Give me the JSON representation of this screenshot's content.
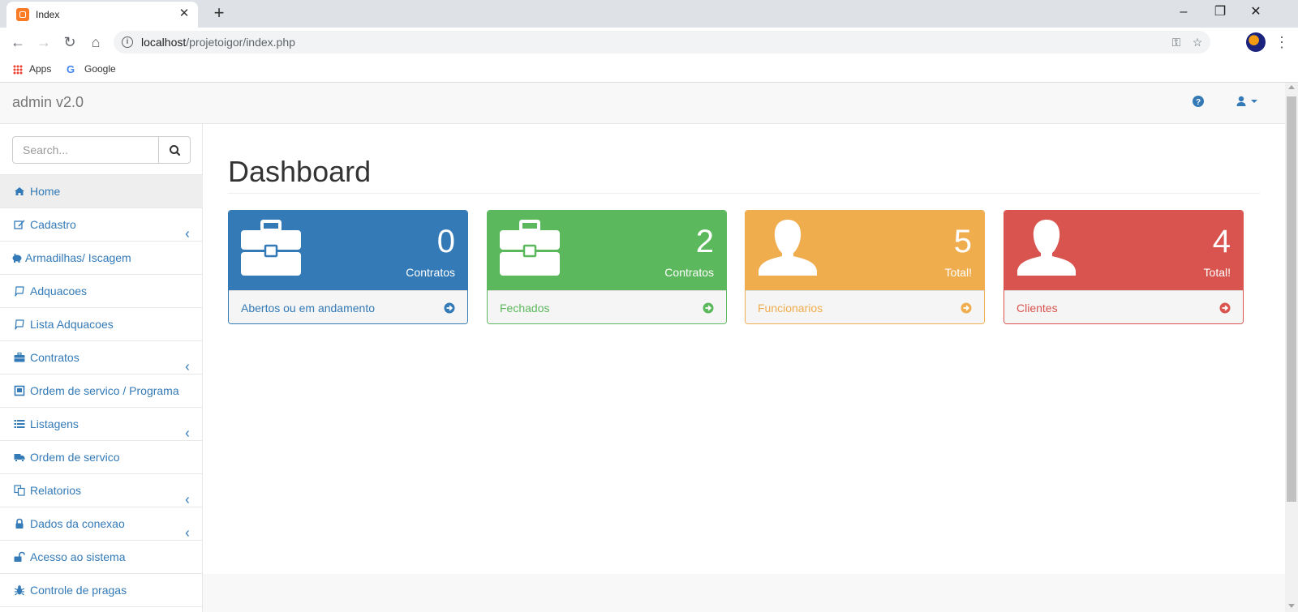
{
  "browser": {
    "tab_title": "Index",
    "url_host": "localhost",
    "url_path": "/projetoigor/index.php",
    "bookmarks": [
      {
        "label": "Apps"
      },
      {
        "label": "Google"
      }
    ]
  },
  "app": {
    "brand": "admin v2.0",
    "search_placeholder": "Search..."
  },
  "sidebar": {
    "items": [
      {
        "label": "Home",
        "icon": "home-icon",
        "expandable": false,
        "active": true
      },
      {
        "label": "Cadastro",
        "icon": "edit-icon",
        "expandable": true,
        "active": false
      },
      {
        "label": "Armadilhas/ Iscagem",
        "icon": "piggy-bank-icon",
        "expandable": false,
        "active": false
      },
      {
        "label": "Adquacoes",
        "icon": "comment-icon",
        "expandable": false,
        "active": false
      },
      {
        "label": "Lista Adquacoes",
        "icon": "comment-icon",
        "expandable": false,
        "active": false
      },
      {
        "label": "Contratos",
        "icon": "briefcase-icon",
        "expandable": true,
        "active": false
      },
      {
        "label": "Ordem de servico / Programa",
        "icon": "window-icon",
        "expandable": false,
        "active": false
      },
      {
        "label": "Listagens",
        "icon": "list-icon",
        "expandable": true,
        "active": false
      },
      {
        "label": "Ordem de servico",
        "icon": "truck-icon",
        "expandable": false,
        "active": false
      },
      {
        "label": "Relatorios",
        "icon": "copy-icon",
        "expandable": true,
        "active": false
      },
      {
        "label": "Dados da conexao",
        "icon": "lock-icon",
        "expandable": true,
        "active": false
      },
      {
        "label": "Acesso ao sistema",
        "icon": "unlock-icon",
        "expandable": false,
        "active": false
      },
      {
        "label": "Controle de pragas",
        "icon": "bug-icon",
        "expandable": false,
        "active": false
      }
    ]
  },
  "main": {
    "title": "Dashboard",
    "panels": [
      {
        "value": "0",
        "subtitle": "Contratos",
        "link": "Abertos ou em andamento",
        "icon": "briefcase-icon",
        "color": "#337ab7"
      },
      {
        "value": "2",
        "subtitle": "Contratos",
        "link": "Fechados",
        "icon": "briefcase-icon",
        "color": "#5cb85c"
      },
      {
        "value": "5",
        "subtitle": "Total!",
        "link": "Funcionarios",
        "icon": "user-icon",
        "color": "#f0ad4e"
      },
      {
        "value": "4",
        "subtitle": "Total!",
        "link": "Clientes",
        "icon": "user-icon",
        "color": "#d9534f"
      }
    ]
  }
}
